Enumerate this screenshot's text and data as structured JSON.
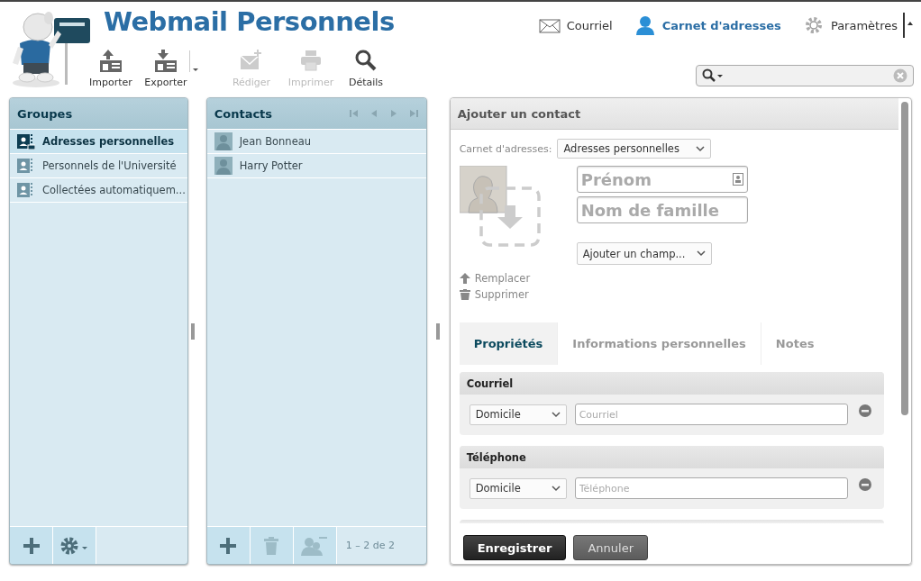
{
  "app": {
    "title": "Webmail Personnels"
  },
  "nav": [
    {
      "label": "Courriel",
      "selected": false
    },
    {
      "label": "Carnet d'adresses",
      "selected": true
    },
    {
      "label": "Paramètres",
      "selected": false
    }
  ],
  "toolbar": [
    {
      "label": "Importer",
      "disabled": false,
      "has_menu": false
    },
    {
      "label": "Exporter",
      "disabled": false,
      "has_menu": true
    },
    {
      "label": "Rédiger",
      "disabled": true,
      "has_menu": false
    },
    {
      "label": "Imprimer",
      "disabled": true,
      "has_menu": false
    },
    {
      "label": "Détails",
      "disabled": false,
      "has_menu": false
    }
  ],
  "groups": {
    "title": "Groupes",
    "items": [
      {
        "label": "Adresses personnelles",
        "selected": true
      },
      {
        "label": "Personnels de l'Université",
        "selected": false
      },
      {
        "label": "Collectées automatiquem...",
        "selected": false
      }
    ]
  },
  "contacts": {
    "title": "Contacts",
    "items": [
      {
        "name": "Jean Bonneau",
        "selected": false
      },
      {
        "name": "Harry Potter",
        "selected": false
      }
    ],
    "count": "1 – 2 de 2"
  },
  "contact_form": {
    "title": "Ajouter un contact",
    "addressbook_label": "Carnet d'adresses:",
    "addressbook_value": "Adresses personnelles",
    "first_name_placeholder": "Prénom",
    "last_name_placeholder": "Nom de famille",
    "add_field": "Ajouter un champ...",
    "photo_actions": [
      "Remplacer",
      "Supprimer"
    ],
    "tabs": [
      {
        "label": "Propriétés",
        "selected": true
      },
      {
        "label": "Informations personnelles",
        "selected": false
      },
      {
        "label": "Notes",
        "selected": false
      }
    ],
    "sections": [
      {
        "title": "Courriel",
        "type_value": "Domicile",
        "placeholder": "Courriel"
      },
      {
        "title": "Téléphone",
        "type_value": "Domicile",
        "placeholder": "Téléphone"
      }
    ],
    "buttons": [
      {
        "label": "Enregistrer",
        "kind": "primary"
      },
      {
        "label": "Annuler",
        "kind": "secondary"
      }
    ]
  }
}
